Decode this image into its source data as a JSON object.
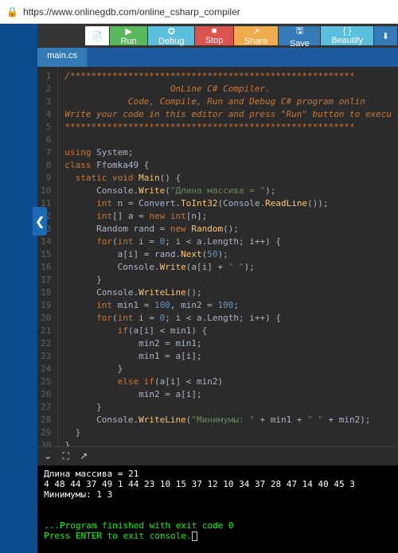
{
  "url": "https://www.onlinegdb.com/online_csharp_compiler",
  "toolbar": {
    "new_icon": "📄",
    "run": "▶ Run",
    "debug": "✪ Debug",
    "stop": "■ Stop",
    "share": "↗ Share",
    "save": "🖫 Save",
    "beautify": "{ } Beautify",
    "download_icon": "⬇"
  },
  "tab": {
    "label": "main.cs"
  },
  "sidebar": {
    "toggle": "❮"
  },
  "code": {
    "lines": [
      "/******************************************************",
      "",
      "                    OnLine C# Compiler.",
      "            Code, Compile, Run and Debug C# program onlin",
      "Write your code in this editor and press \"Run\" button to execu",
      "",
      "*******************************************************",
      "",
      "using System;",
      "class Ffomka49 {",
      "  static void Main() {",
      "      Console.Write(\"Длина массива = \");",
      "      int n = Convert.ToInt32(Console.ReadLine());",
      "      int[] a = new int[n];",
      "      Random rand = new Random();",
      "      for(int i = 0; i < a.Length; i++) {",
      "          a[i] = rand.Next(50);",
      "          Console.Write(a[i] + \" \");",
      "      }",
      "      Console.WriteLine();",
      "      int min1 = 100, min2 = 100;",
      "      for(int i = 0; i < a.Length; i++) {",
      "          if(a[i] < min1) {",
      "              min2 = min1;",
      "              min1 = a[i];",
      "          }",
      "          else if(a[i] < min2)",
      "              min2 = a[i];",
      "      }",
      "      Console.WriteLine(\"Минимумы: \" + min1 + \" \" + min2);",
      "  }",
      "}"
    ]
  },
  "console_controls": {
    "expand": "⌄",
    "fullscreen": "⛶",
    "pop": "↗"
  },
  "console": {
    "lines": [
      "Длина массива = 21",
      "4 48 44 37 49 1 44 23 10 15 37 12 10 34 37 28 47 14 40 45 3",
      "Минимумы: 1 3",
      "",
      "",
      "...Program finished with exit code 0",
      "Press ENTER to exit console."
    ]
  }
}
